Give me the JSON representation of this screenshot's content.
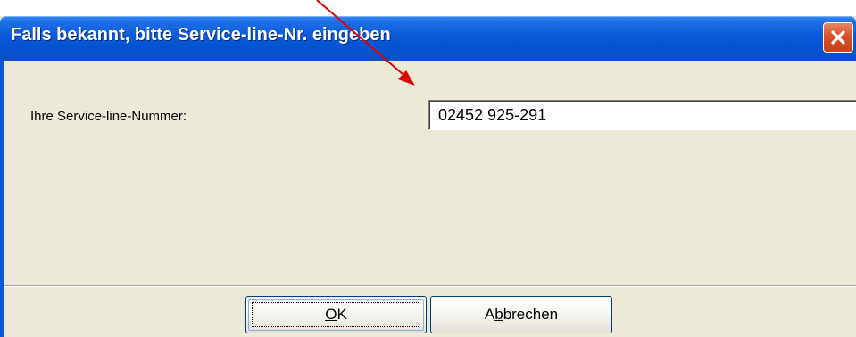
{
  "dialog": {
    "title": "Falls bekannt, bitte Service-line-Nr. eingeben",
    "close_icon": "close-icon"
  },
  "form": {
    "label": "Ihre Service-line-Nummer:",
    "value": "02452 925-291"
  },
  "buttons": {
    "ok_label": "OK",
    "ok_mnemonic": "O",
    "ok_rest": "K",
    "cancel_label": "Abbrechen",
    "cancel_prefix": "A",
    "cancel_mnemonic": "b",
    "cancel_rest": "brechen"
  },
  "annotation": {
    "icon": "arrow-icon",
    "color": "#e00000"
  },
  "colors": {
    "titlebar": "#0553d2",
    "dialog_bg": "#ece9d8",
    "close_button": "#d9512a",
    "button_border": "#003c74"
  }
}
